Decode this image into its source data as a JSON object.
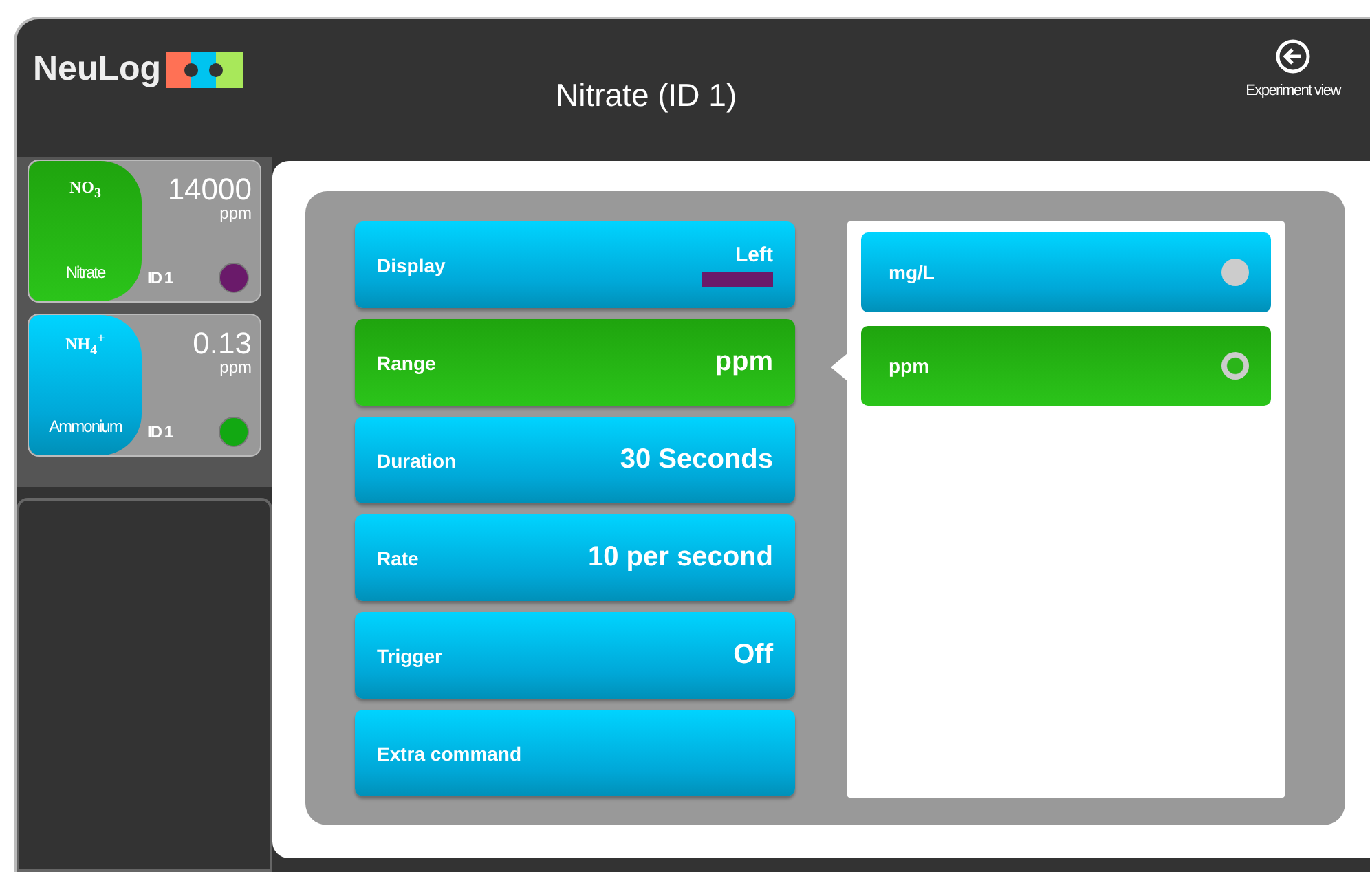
{
  "header": {
    "logo": "NeuLog",
    "title": "Nitrate (ID 1)",
    "experiment_button": "Experiment view"
  },
  "sensors": [
    {
      "formula": "NO$_{3}$",
      "name": "Nitrate",
      "value": "14000",
      "unit": "ppm",
      "id": "ID 1",
      "color": "#6a1a6a",
      "kind": "green"
    },
    {
      "formula": "NH$_{4}$$^{+}$",
      "name": "Ammonium",
      "value": "0.13",
      "unit": "ppm",
      "id": "ID 1",
      "color": "#12a812",
      "kind": "blue"
    }
  ],
  "menu": [
    {
      "label": "Display",
      "value": "Left",
      "color": "#6a1a6a",
      "selected": false
    },
    {
      "label": "Range",
      "value": "ppm",
      "selected": true
    },
    {
      "label": "Duration",
      "value": "30 Seconds",
      "selected": false
    },
    {
      "label": "Rate",
      "value": "10 per second",
      "selected": false
    },
    {
      "label": "Trigger",
      "value": "Off",
      "selected": false
    },
    {
      "label": "Extra command",
      "selected": false
    }
  ],
  "options": [
    {
      "label": "mg/L",
      "selected": false
    },
    {
      "label": "ppm",
      "selected": true
    }
  ]
}
